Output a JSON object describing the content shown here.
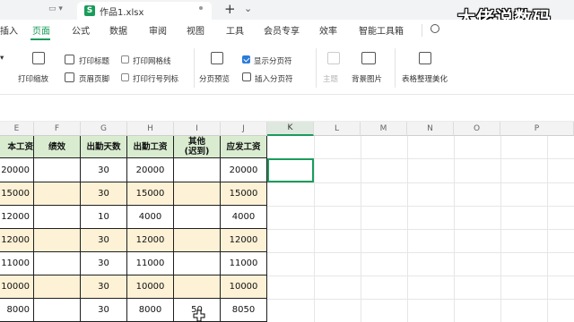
{
  "titlebar": {
    "doc_name": "作品1.xlsx",
    "new_tab": "+",
    "more": "⌄"
  },
  "watermark": "大佬说数码",
  "menu": {
    "items": [
      "插入",
      "页面",
      "公式",
      "数据",
      "审阅",
      "视图",
      "工具",
      "会员专享",
      "效率",
      "智能工具箱"
    ],
    "active": "页面",
    "accent": "#1a9c5b"
  },
  "ribbon": {
    "print_title": "打印标题",
    "print_gridlines": "打印网格线",
    "print_scale": "打印缩放",
    "header_footer": "页眉页脚",
    "print_rowcol": "打印行号列标",
    "show_pagebreak": "显示分页符",
    "pagebreak_preview": "分页预览",
    "insert_pagebreak": "插入分页符",
    "theme": "主题",
    "bg_image": "背景图片",
    "table_beautify": "表格整理美化"
  },
  "columns": [
    "E",
    "F",
    "G",
    "H",
    "I",
    "J",
    "K",
    "L",
    "M",
    "N",
    "O",
    "P"
  ],
  "selected_column": "K",
  "table": {
    "headers": [
      "本工资",
      "绩效",
      "出勤天数",
      "出勤工资",
      "其他\n(迟到)",
      "应发工资"
    ],
    "rows": [
      [
        "20000",
        "",
        "30",
        "20000",
        "",
        "20000"
      ],
      [
        "15000",
        "",
        "30",
        "15000",
        "",
        "15000"
      ],
      [
        "12000",
        "",
        "10",
        "4000",
        "",
        "4000"
      ],
      [
        "12000",
        "",
        "30",
        "12000",
        "",
        "12000"
      ],
      [
        "11000",
        "",
        "30",
        "11000",
        "",
        "11000"
      ],
      [
        "10000",
        "",
        "30",
        "10000",
        "",
        "10000"
      ],
      [
        "8000",
        "",
        "30",
        "8000",
        "50",
        "8050"
      ]
    ],
    "header_color": "#d9ecd0",
    "stripe_color": "#fdf1d6"
  }
}
